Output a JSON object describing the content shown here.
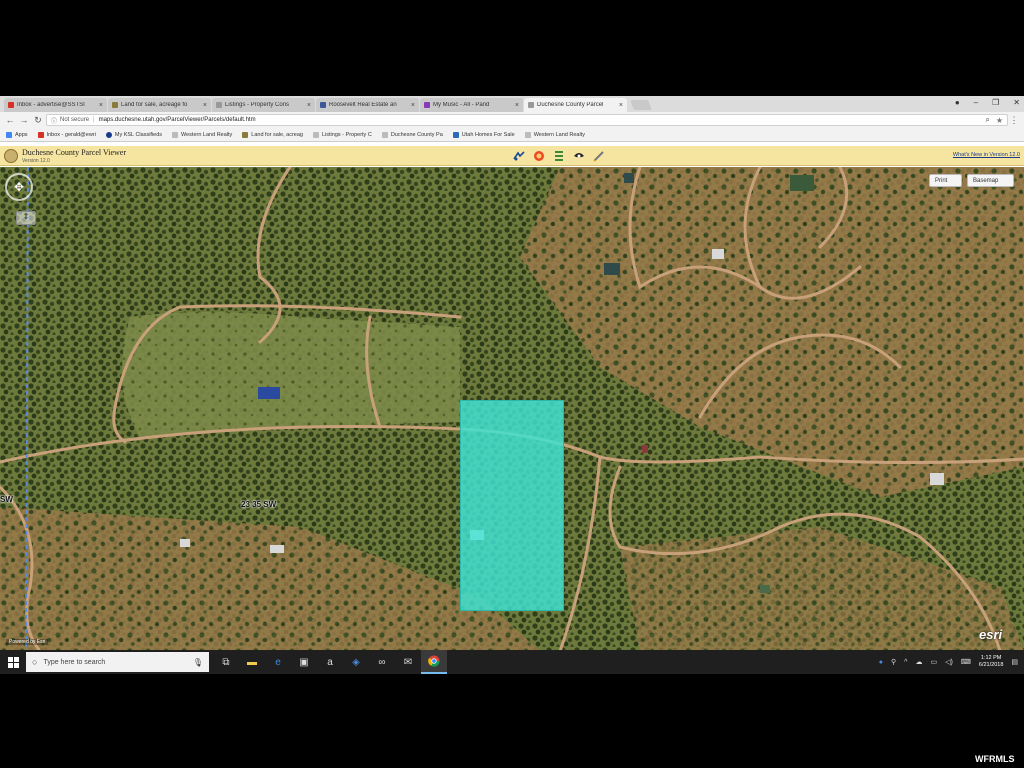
{
  "browser": {
    "tabs": [
      {
        "label": "Inbox - advertise@SSTSI",
        "icon": "gmail-icon",
        "color": "#d93025",
        "active": false
      },
      {
        "label": "Land for sale, acreage fo",
        "icon": "land-site-icon",
        "color": "#8a7a3a",
        "active": false
      },
      {
        "label": "Listings - Property Cons",
        "icon": "page-icon",
        "color": "#999999",
        "active": false
      },
      {
        "label": "Roosevelt Real Estate an",
        "icon": "facebook-icon",
        "color": "#3b5998",
        "active": false
      },
      {
        "label": "My Music - All - Pand",
        "icon": "pandora-icon",
        "color": "#8a3ab9",
        "active": false
      },
      {
        "label": "Duchesne County Parcel",
        "icon": "page-icon",
        "color": "#999999",
        "active": true
      }
    ],
    "security_label": "Not secure",
    "url": "maps.duchesne.utah.gov/ParcelViewer/Parcels/default.htm",
    "bookmarks": [
      {
        "label": "Apps",
        "color": "#4285f4"
      },
      {
        "label": "Inbox - gerald@ewri",
        "color": "#d93025"
      },
      {
        "label": "My KSL Classifieds",
        "color": "#1a3a8a"
      },
      {
        "label": "Western Land Realty",
        "color": "#999999"
      },
      {
        "label": "Land for sale, acreag",
        "color": "#8a7a3a"
      },
      {
        "label": "Listings - Property C",
        "color": "#999999"
      },
      {
        "label": "Duchesne County Pa",
        "color": "#999999"
      },
      {
        "label": "Utah Homes For Sale",
        "color": "#2a6ab9"
      },
      {
        "label": "Western Land Realty",
        "color": "#999999"
      }
    ]
  },
  "app": {
    "title": "Duchesne County Parcel Viewer",
    "version": "Version 12.0",
    "whats_new": "What's New in Version 12.0",
    "tools": [
      "measure-icon",
      "record-icon",
      "layers-icon",
      "identify-icon",
      "draw-icon"
    ]
  },
  "map": {
    "buttons": {
      "print": "Print",
      "basemap": "Basemap"
    },
    "labels": {
      "road": "23 35 SW",
      "edge": "SW"
    },
    "esri": "esri",
    "scale": "Powered by Esri",
    "parcel_color": "#40e0d0"
  },
  "taskbar": {
    "search_placeholder": "Type here to search",
    "time": "1:12 PM",
    "date": "6/21/2018"
  },
  "watermark": "WFRMLS"
}
